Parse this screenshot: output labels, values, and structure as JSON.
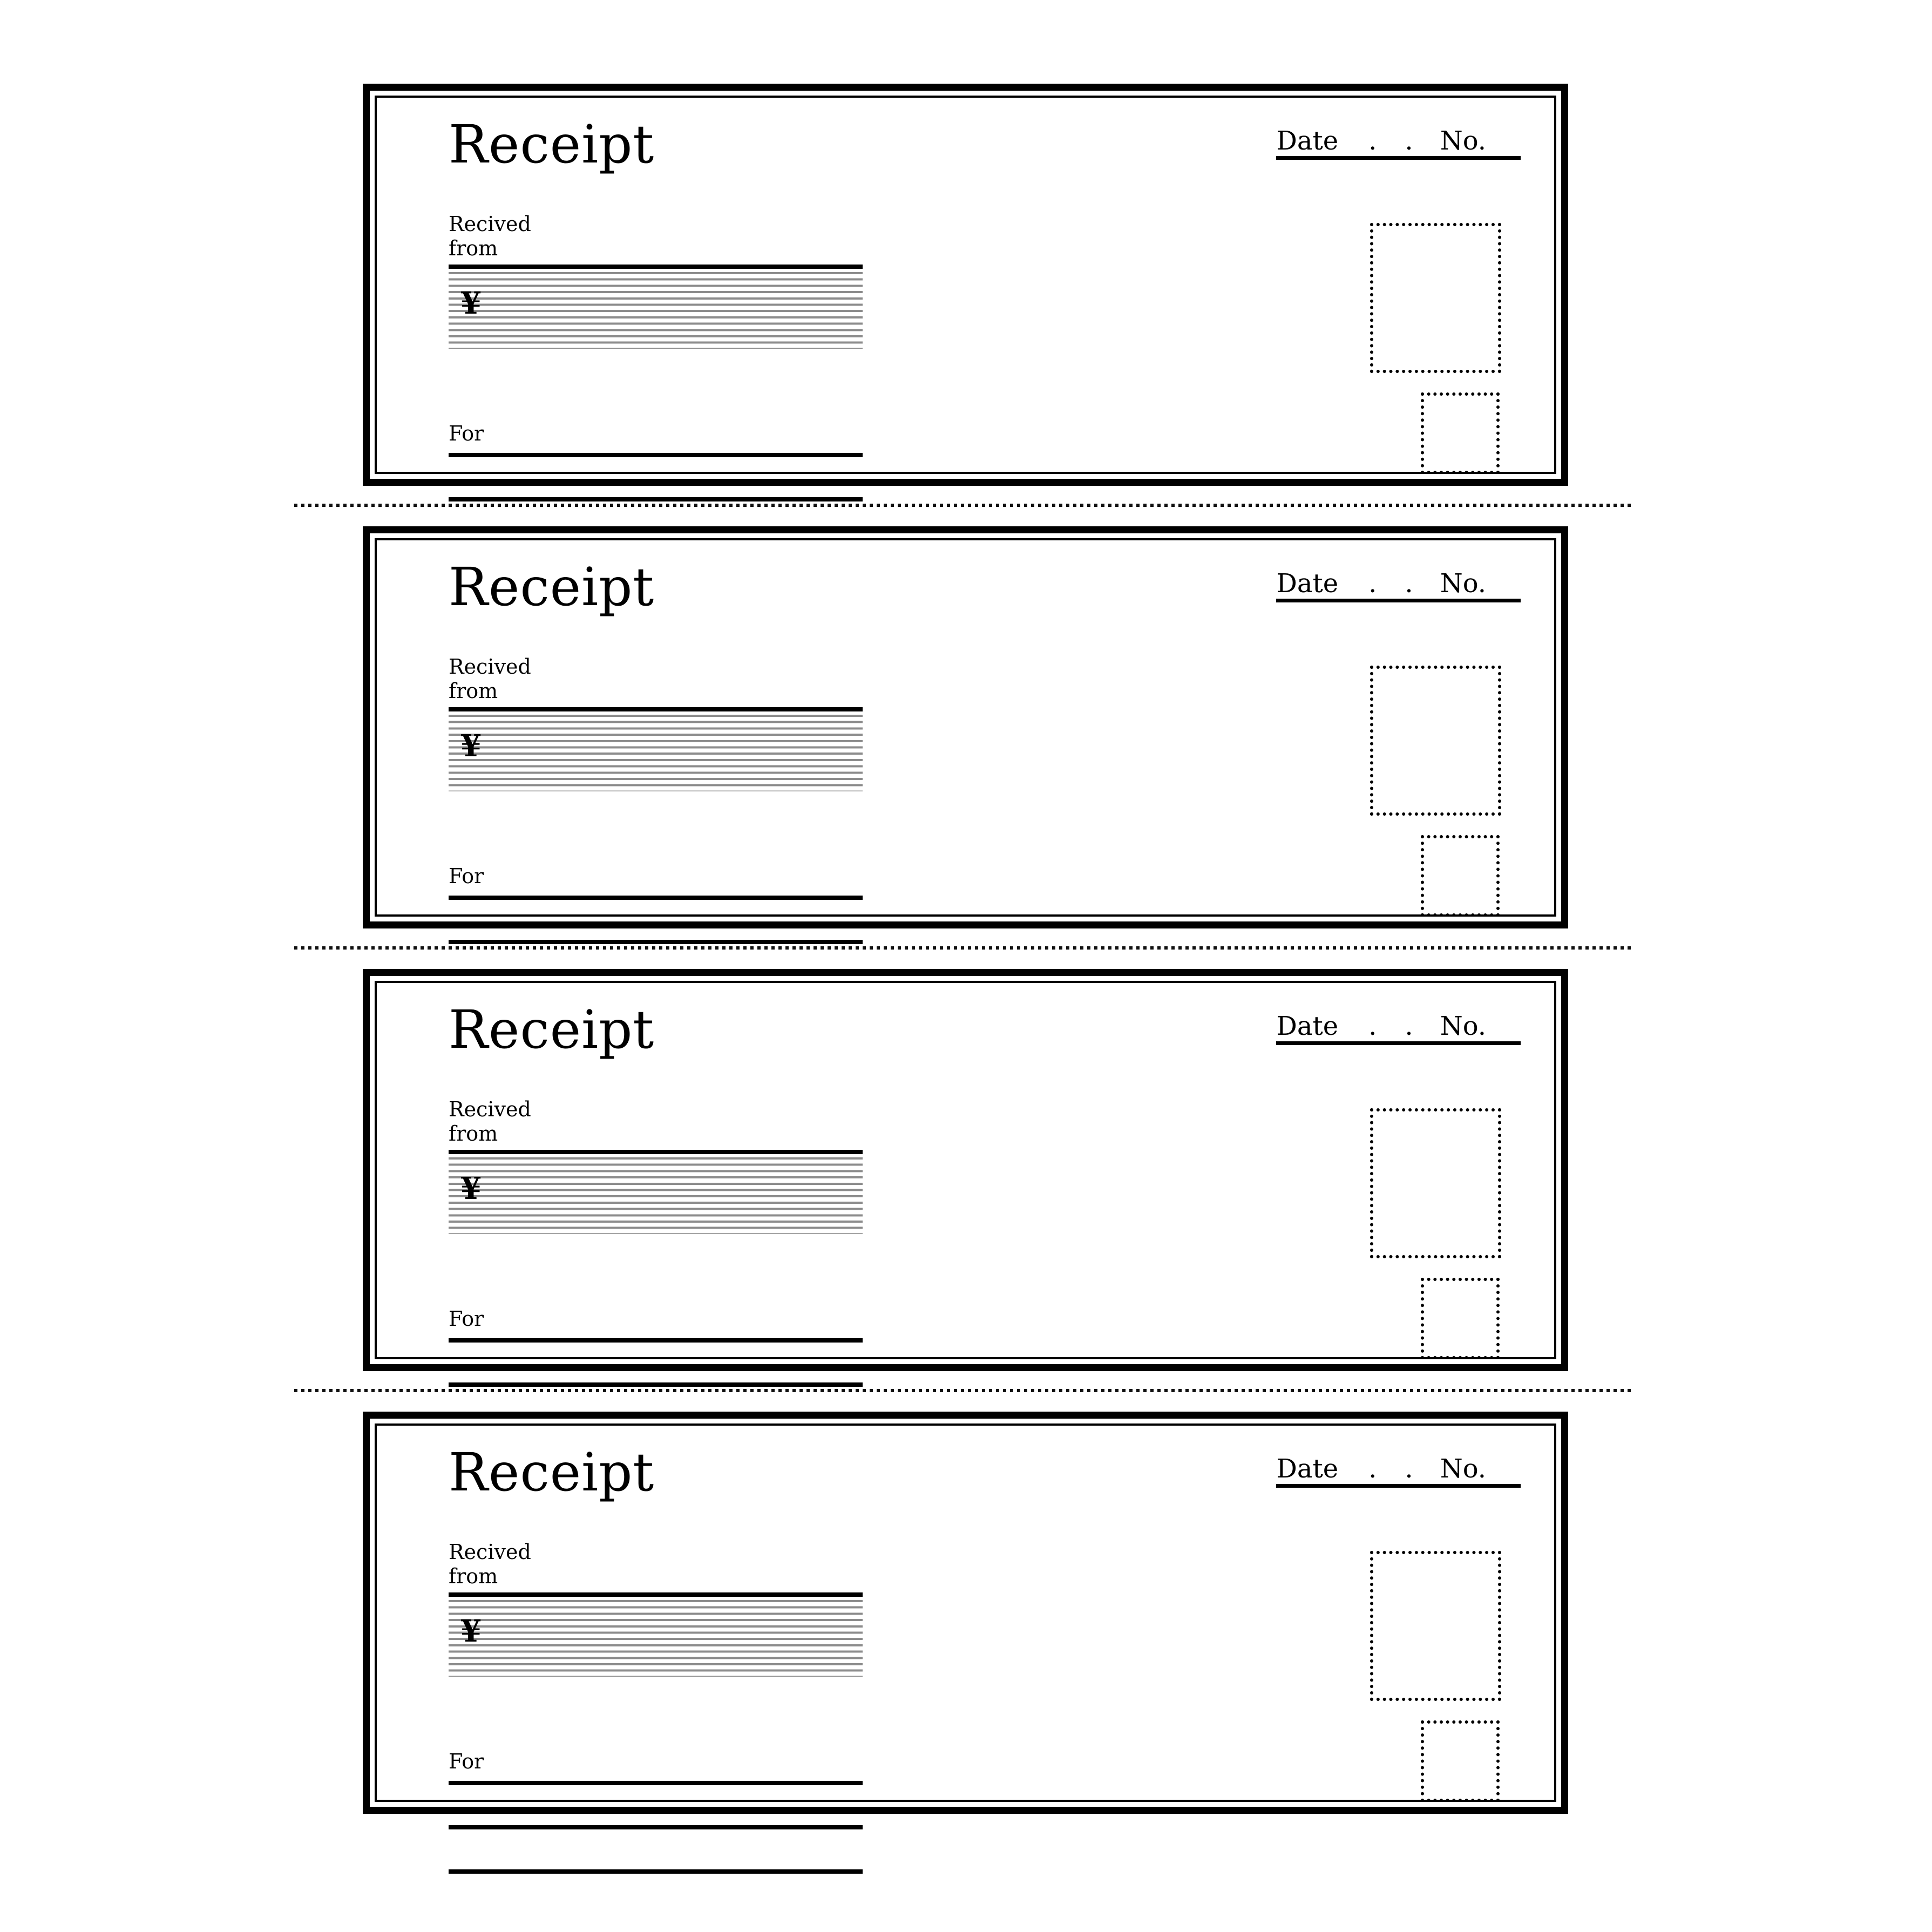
{
  "document": {
    "kind": "receipt-book-template",
    "page_background": "#ffffff",
    "ink_color": "#000000",
    "rule_color_light": "#8c8c8c",
    "receipt_count": 4
  },
  "receipt": {
    "title": "Receipt",
    "date_label": "Date",
    "date_separator_1": ".",
    "date_separator_2": ".",
    "number_label": "No.",
    "received_from_line_1": "Recived",
    "received_from_line_2": "from",
    "currency_symbol": "¥",
    "for_label": "For",
    "amount_line_count": 12,
    "for_line_count": 3,
    "stamp_box_label": "",
    "seal_box_label": ""
  },
  "receipts": [
    {
      "index": 1,
      "title": "Receipt",
      "date_label": "Date",
      "date_separator_1": ".",
      "date_separator_2": ".",
      "number_label": "No.",
      "received_from_line_1": "Recived",
      "received_from_line_2": "from",
      "currency_symbol": "¥",
      "for_label": "For"
    },
    {
      "index": 2,
      "title": "Receipt",
      "date_label": "Date",
      "date_separator_1": ".",
      "date_separator_2": ".",
      "number_label": "No.",
      "received_from_line_1": "Recived",
      "received_from_line_2": "from",
      "currency_symbol": "¥",
      "for_label": "For"
    },
    {
      "index": 3,
      "title": "Receipt",
      "date_label": "Date",
      "date_separator_1": ".",
      "date_separator_2": ".",
      "number_label": "No.",
      "received_from_line_1": "Recived",
      "received_from_line_2": "from",
      "currency_symbol": "¥",
      "for_label": "For"
    },
    {
      "index": 4,
      "title": "Receipt",
      "date_label": "Date",
      "date_separator_1": ".",
      "date_separator_2": ".",
      "number_label": "No.",
      "received_from_line_1": "Recived",
      "received_from_line_2": "from",
      "currency_symbol": "¥",
      "for_label": "For"
    }
  ]
}
